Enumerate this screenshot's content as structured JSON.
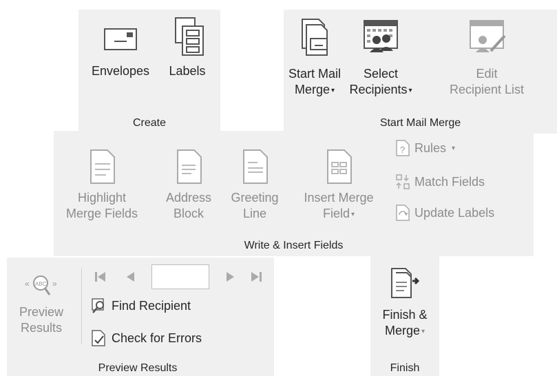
{
  "create": {
    "group_label": "Create",
    "envelopes_label": "Envelopes",
    "labels_label": "Labels"
  },
  "start_mail_merge": {
    "group_label": "Start Mail Merge",
    "start_line1": "Start Mail",
    "start_line2": "Merge",
    "select_line1": "Select",
    "select_line2": "Recipients",
    "edit_line1": "Edit",
    "edit_line2": "Recipient List"
  },
  "write_insert": {
    "group_label": "Write & Insert Fields",
    "highlight_line1": "Highlight",
    "highlight_line2": "Merge Fields",
    "address_line1": "Address",
    "address_line2": "Block",
    "greeting_line1": "Greeting",
    "greeting_line2": "Line",
    "insert_line1": "Insert Merge",
    "insert_line2": "Field",
    "rules_label": "Rules",
    "match_label": "Match Fields",
    "update_label": "Update Labels"
  },
  "preview": {
    "group_label": "Preview Results",
    "preview_line1": "Preview",
    "preview_line2": "Results",
    "record_value": "",
    "find_label": "Find Recipient",
    "check_label": "Check for Errors",
    "abc_text": "ABC"
  },
  "finish": {
    "group_label": "Finish",
    "finish_line1": "Finish &",
    "finish_line2": "Merge"
  },
  "caret_glyph": "▾",
  "colors": {
    "panel": "#f0f0f0",
    "text": "#262626",
    "disabled": "#8c8c8c",
    "accent": "#2b579a"
  }
}
